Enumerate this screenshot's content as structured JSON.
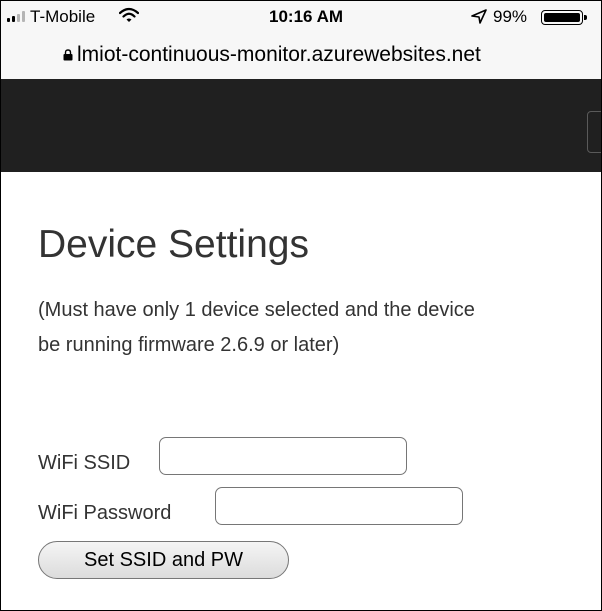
{
  "status_bar": {
    "carrier": "T-Mobile",
    "time": "10:16 AM",
    "battery": "99%",
    "icons": [
      "signal-icon",
      "wifi-icon",
      "location-icon",
      "battery-icon"
    ]
  },
  "browser": {
    "url": "lmiot-continuous-monitor.azurewebsites.net",
    "icons": [
      "lock-icon"
    ]
  },
  "main": {
    "title": "Device Settings",
    "note_line1": "(Must have only 1 device selected and the device",
    "note_line2": "be running firmware 2.6.9 or later)",
    "ssid_label": "WiFi SSID",
    "ssid_value": "",
    "password_label": "WiFi Password",
    "password_value": "",
    "submit_label": "Set SSID and PW"
  },
  "colors": {
    "header_bg": "#202020",
    "text": "#333333",
    "chrome_bg": "#f7f7f7"
  }
}
